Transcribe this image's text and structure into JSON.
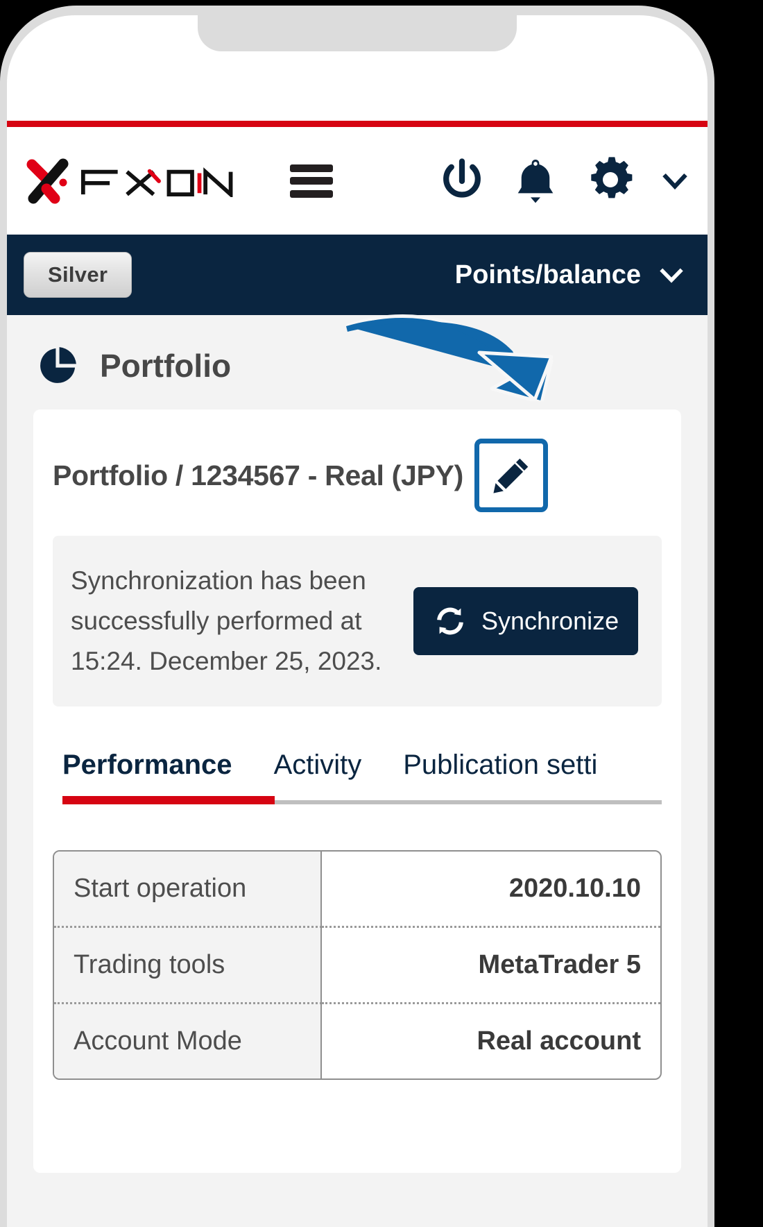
{
  "brand": {
    "logo_name": "FXON",
    "accent_red": "#d60412",
    "navy": "#0a2540",
    "highlight_blue": "#1168ab"
  },
  "header": {
    "menu_icon": "hamburger-icon",
    "power_icon": "power-icon",
    "bell_icon": "bell-icon",
    "gear_icon": "gear-icon",
    "chevron_icon": "chevron-down-icon"
  },
  "subnav": {
    "rank_badge": "Silver",
    "points_balance_label": "Points/balance",
    "points_balance_chevron": "chevron-down-icon"
  },
  "page": {
    "icon": "pie-chart-icon",
    "title": "Portfolio"
  },
  "card": {
    "heading": "Portfolio / 1234567 - Real (JPY)",
    "edit_icon": "pencil-icon",
    "sync": {
      "message": "Synchronization has been successfully performed at 15:24. December 25, 2023.",
      "button_label": "Synchronize",
      "button_icon": "refresh-icon"
    },
    "tabs": [
      {
        "label": "Performance",
        "active": true
      },
      {
        "label": "Activity",
        "active": false
      },
      {
        "label": "Publication setti",
        "active": false
      }
    ],
    "table": {
      "rows": [
        {
          "label": "Start operation",
          "value": "2020.10.10"
        },
        {
          "label": "Trading tools",
          "value": "MetaTrader 5"
        },
        {
          "label": "Account Mode",
          "value": "Real account"
        }
      ]
    }
  },
  "annotation": {
    "arrow": "curved-arrow-annotation",
    "arrow_color": "#1168ab",
    "target": "edit-portfolio-button"
  }
}
